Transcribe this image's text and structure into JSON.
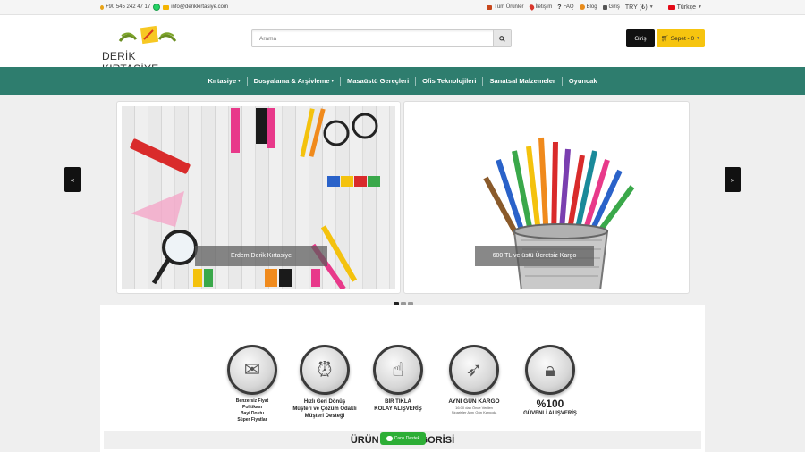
{
  "topbar": {
    "phone": "+90 545 242 47 17",
    "email": "info@derikkirtasiye.com",
    "all_products": "Tüm Ürünler",
    "contact": "İletişim",
    "faq": "FAQ",
    "blog": "Blog",
    "login": "Giriş",
    "currency": "TRY (₺)",
    "language": "Türkçe"
  },
  "header": {
    "logo_text": "DERİK KIRTASİYE",
    "search_placeholder": "Arama",
    "login_button": "Giriş",
    "cart_button": "Sepet - 0"
  },
  "nav": {
    "items": [
      {
        "label": "Kırtasiye",
        "has_dropdown": true
      },
      {
        "label": "Dosyalama & Arşivleme",
        "has_dropdown": true
      },
      {
        "label": "Masaüstü Gereçleri",
        "has_dropdown": false
      },
      {
        "label": "Ofis Teknolojileri",
        "has_dropdown": false
      },
      {
        "label": "Sanatsal Malzemeler",
        "has_dropdown": false
      },
      {
        "label": "Oyuncak",
        "has_dropdown": false
      }
    ]
  },
  "slider": {
    "prev": "«",
    "next": "»",
    "slides": [
      {
        "caption": "Erdem Derik Kırtasiye"
      },
      {
        "caption": "600 TL ve üstü Ücretsiz Kargo"
      }
    ],
    "dots": 3,
    "active_dot": 0
  },
  "features": [
    {
      "icon": "price-tag-icon",
      "lines": [
        "Benzersiz Fiyat",
        "Politikası",
        "Bayi Dostu",
        "Süper Fiyatlar"
      ]
    },
    {
      "icon": "alarm-clock-icon",
      "lines": [
        "Hızlı Geri Dönüş",
        "Müşteri ve Çözüm Odaklı",
        "Müşteri Desteği"
      ]
    },
    {
      "icon": "pointer-hand-icon",
      "lines": [
        "BİR TIKLA",
        "KOLAY ALIŞVERİŞ"
      ]
    },
    {
      "icon": "rocket-icon",
      "lines": [
        "AYNI GÜN KARGO"
      ],
      "small": [
        "16:00 dan Önce Verilen",
        "Siparişler Aynı Gün Kargoda"
      ]
    },
    {
      "icon": "padlock-icon",
      "big": "%100",
      "lines": [
        "GÜVENLİ ALIŞVERİŞ"
      ]
    }
  ],
  "category_title_left": "ÜRÜN",
  "category_title_right": "GORİSİ",
  "chat_button": "Canlı Destek",
  "colors": {
    "nav": "#2e7d6e",
    "cart": "#f6c40f",
    "chat": "#2dae36"
  }
}
